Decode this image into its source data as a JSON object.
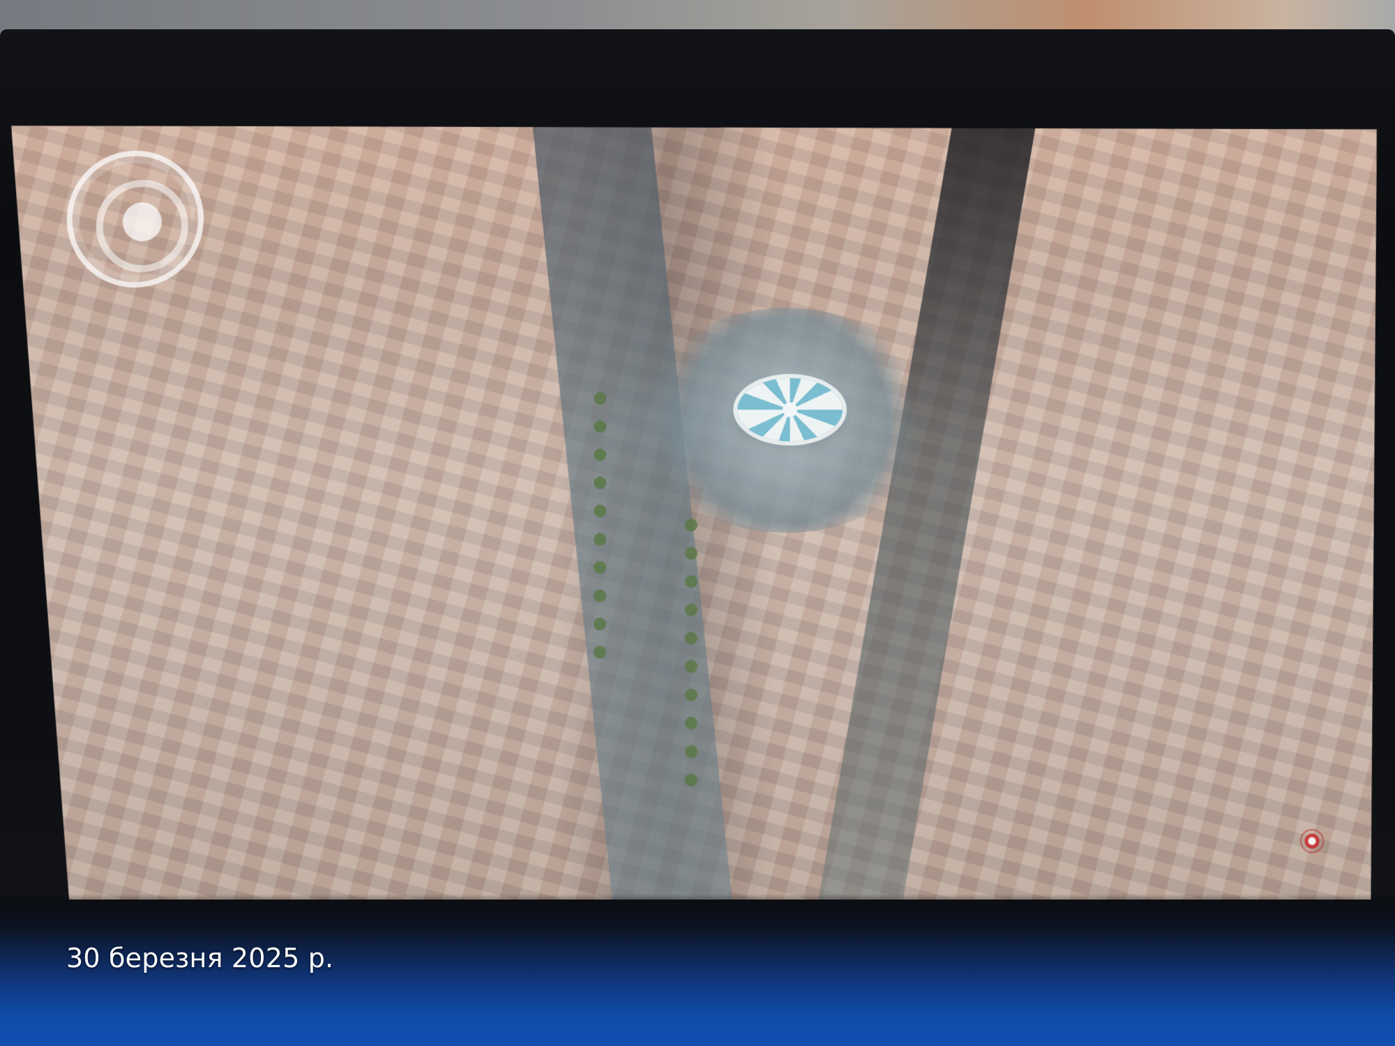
{
  "photo": {
    "timestamp_text": "30 березня 2025 р."
  },
  "video_overlay": {
    "play_control_icon": "play-control-icon",
    "corner_indicator_icon": "recording-indicator-icon"
  }
}
